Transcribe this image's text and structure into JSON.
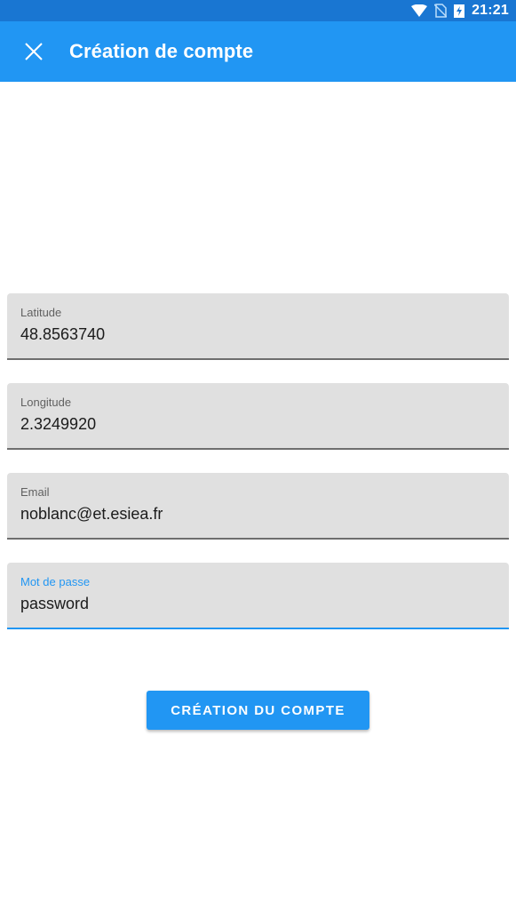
{
  "status_bar": {
    "time": "21:21",
    "icons": [
      "wifi-icon",
      "no-sim-icon",
      "battery-charging-icon"
    ]
  },
  "app_bar": {
    "close_icon": "close-icon",
    "title": "Création de compte"
  },
  "form": {
    "latitude": {
      "label": "Latitude",
      "value": "48.8563740"
    },
    "longitude": {
      "label": "Longitude",
      "value": "2.3249920"
    },
    "email": {
      "label": "Email",
      "value": "noblanc@et.esiea.fr"
    },
    "password": {
      "label": "Mot de passe",
      "value": "password",
      "focused": true
    }
  },
  "submit_button": {
    "label": "CRÉATION DU COMPTE"
  },
  "colors": {
    "status_bar": "#1976d2",
    "app_bar": "#2196f3",
    "accent": "#2196f3",
    "field_bg": "#e0e0e0"
  }
}
